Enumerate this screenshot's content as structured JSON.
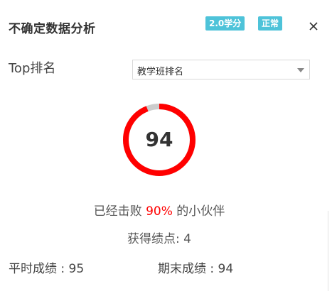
{
  "dialog": {
    "title": "不确定数据分析",
    "close_icon": "close-icon"
  },
  "badges": {
    "credit": {
      "label": "2.0学分",
      "color": "#4ec3d9"
    },
    "status": {
      "label": "正常",
      "color": "#4ec3d9"
    }
  },
  "ranking": {
    "label": "Top排名",
    "select": {
      "value": "教学班排名",
      "icon": "chevron-down-icon"
    }
  },
  "progress": {
    "score": "94",
    "fraction": 0.94,
    "fill_color": "#ff0000",
    "track_color": "#cccccc"
  },
  "beat": {
    "prefix": "已经击败",
    "percent": "90%",
    "suffix": "的小伙伴",
    "percent_color": "#ff0000"
  },
  "gpa": {
    "label": "获得绩点:",
    "value": "4"
  },
  "scores": {
    "regular_label": "平时成绩",
    "regular_value": "95",
    "final_label": "期末成绩",
    "final_value": "94"
  }
}
